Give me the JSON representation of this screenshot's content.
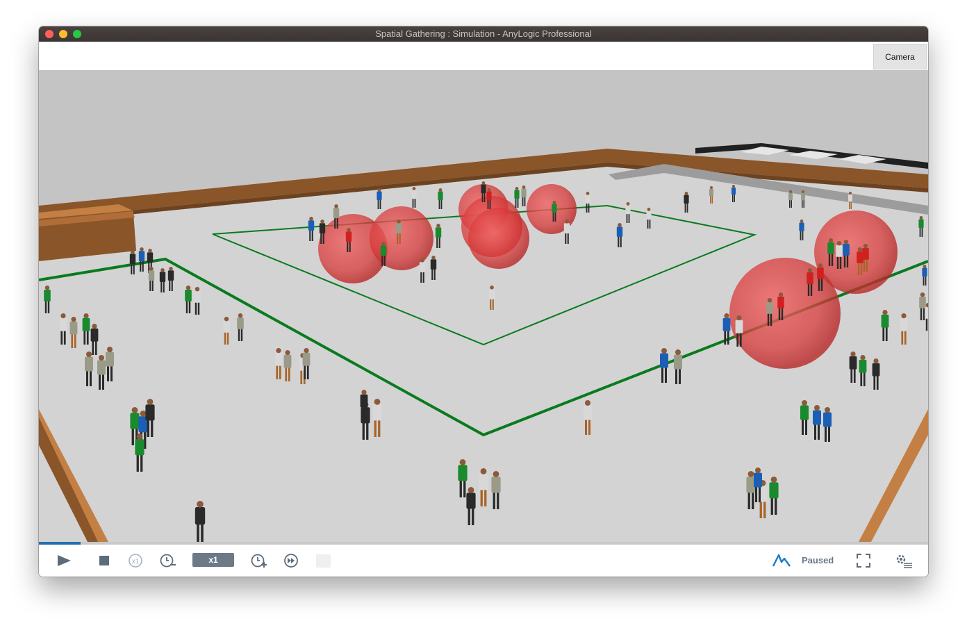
{
  "window": {
    "title": "Spatial Gathering : Simulation - AnyLogic Professional"
  },
  "top_toolbar": {
    "camera_label": "Camera"
  },
  "scene": {
    "description_icons": [
      "person-figure-icon",
      "gathering-sphere-icon"
    ],
    "colors": {
      "floor": "#c4c4c4",
      "walls": "#8a5528",
      "zone_border": "#0a7a1e",
      "sphere": "#e03a3a"
    }
  },
  "controls": {
    "speed_label": "x1",
    "status": "Paused",
    "progress_fraction": 0.047,
    "icons": [
      "play-icon",
      "stop-icon",
      "realtime-x1-icon",
      "slow-down-icon",
      "speed-up-icon",
      "fast-forward-icon",
      "anylogic-logo-icon",
      "fullscreen-icon",
      "settings-icon"
    ]
  }
}
